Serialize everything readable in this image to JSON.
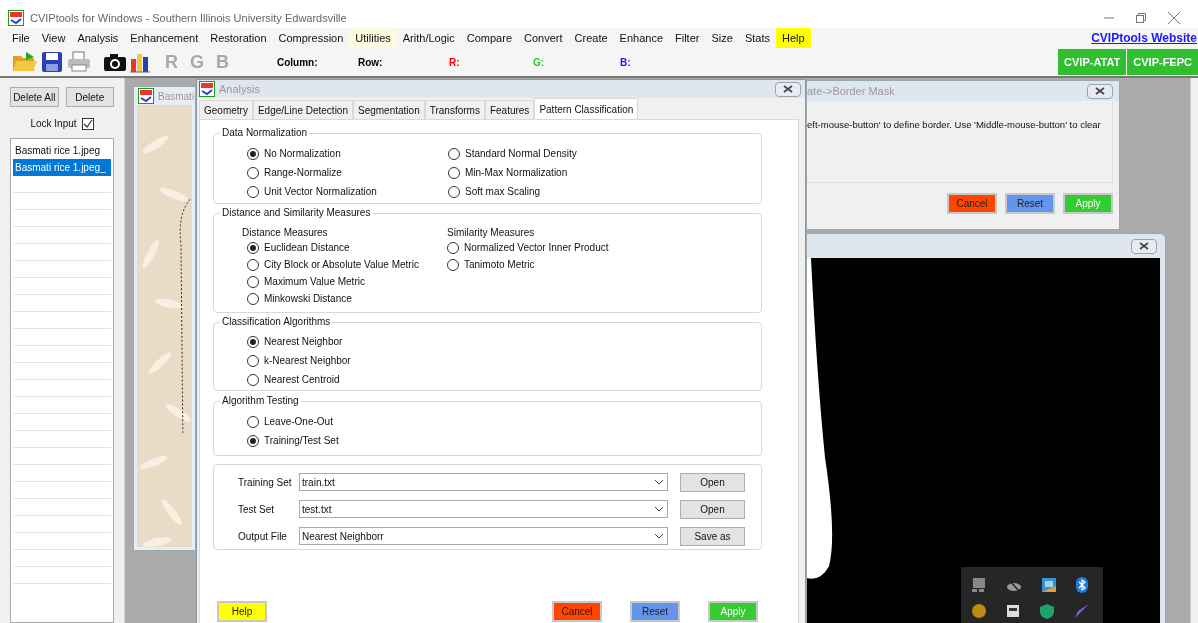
{
  "window": {
    "title": "CVIPtools for Windows - Southern Illinois University Edwardsville"
  },
  "menu": [
    {
      "label": "File"
    },
    {
      "label": "View"
    },
    {
      "label": "Analysis"
    },
    {
      "label": "Enhancement"
    },
    {
      "label": "Restoration"
    },
    {
      "label": "Compression"
    },
    {
      "label": "Utilities",
      "color": "#fbfbe0"
    },
    {
      "label": "Arith/Logic"
    },
    {
      "label": "Compare"
    },
    {
      "label": "Convert"
    },
    {
      "label": "Create"
    },
    {
      "label": "Enhance"
    },
    {
      "label": "Filter"
    },
    {
      "label": "Size"
    },
    {
      "label": "Stats"
    },
    {
      "label": "Help",
      "color": "#ffff00"
    }
  ],
  "website_link": "CVIPtools Website",
  "toolbar": {
    "channels": [
      "R",
      "G",
      "B"
    ],
    "readouts": [
      {
        "label": "Column:",
        "color": "#000000"
      },
      {
        "label": "Row:",
        "color": "#000000"
      },
      {
        "label": "R:",
        "color": "#ff0000"
      },
      {
        "label": "G:",
        "color": "#22cc22"
      },
      {
        "label": "B:",
        "color": "#1a1aff"
      }
    ],
    "tool_buttons": [
      "CVIP-ATAT",
      "CVIP-FEPC"
    ]
  },
  "left_panel": {
    "buttons": [
      "Delete All",
      "Delete"
    ],
    "lock_input": {
      "label": "Lock Input",
      "checked": true
    },
    "images": [
      {
        "name": "Basmati rice 1.jpeg",
        "selected": false
      },
      {
        "name": "Basmati rice 1.jpeg_",
        "selected": true
      }
    ]
  },
  "image_window": {
    "title": "Basmati"
  },
  "analysis": {
    "title": "Analysis",
    "tabs": [
      {
        "label": "Geometry",
        "selected": false
      },
      {
        "label": "Edge/Line Detection",
        "selected": false
      },
      {
        "label": "Segmentation",
        "selected": false
      },
      {
        "label": "Transforms",
        "selected": false
      },
      {
        "label": "Features",
        "selected": false
      },
      {
        "label": "Pattern Classification",
        "selected": true
      }
    ],
    "data_normalization": {
      "title": "Data Normalization",
      "columns": [
        [
          {
            "label": "No Normalization",
            "selected": true
          },
          {
            "label": "Range-Normalize",
            "selected": false
          },
          {
            "label": "Unit Vector Normalization",
            "selected": false
          }
        ],
        [
          {
            "label": "Standard Normal Density",
            "selected": false
          },
          {
            "label": "Min-Max Normalization",
            "selected": false
          },
          {
            "label": "Soft max Scaling",
            "selected": false
          }
        ]
      ]
    },
    "distance_similarity": {
      "title": "Distance and Similarity Measures",
      "sections": [
        {
          "heading": "Distance Measures",
          "options": [
            {
              "label": "Euclidean Distance",
              "selected": true
            },
            {
              "label": "City Block or Absolute Value Metric",
              "selected": false
            },
            {
              "label": "Maximum Value Metric",
              "selected": false
            },
            {
              "label": "Minkowski Distance",
              "selected": false
            }
          ]
        },
        {
          "heading": "Similarity Measures",
          "options": [
            {
              "label": "Normalized Vector Inner Product",
              "selected": false
            },
            {
              "label": "Tanimoto Metric",
              "selected": false
            }
          ]
        }
      ]
    },
    "classification": {
      "title": "Classification Algorithms",
      "options": [
        {
          "label": "Nearest Neighbor",
          "selected": true
        },
        {
          "label": "k-Nearest Neighbor",
          "selected": false
        },
        {
          "label": "Nearest Centroid",
          "selected": false
        }
      ]
    },
    "algorithm_testing": {
      "title": "Algorithm Testing",
      "options": [
        {
          "label": "Leave-One-Out",
          "selected": false
        },
        {
          "label": "Training/Test Set",
          "selected": true
        }
      ]
    },
    "files": [
      {
        "label": "Training Set",
        "value": "train.txt",
        "button": "Open"
      },
      {
        "label": "Test Set",
        "value": "test.txt",
        "button": "Open"
      },
      {
        "label": "Output File",
        "value": "Nearest Neighborr",
        "button": "Save as"
      }
    ],
    "buttons": [
      {
        "label": "Help",
        "color": "#ffff00"
      },
      {
        "label": "Cancel",
        "color": "#ff4500"
      },
      {
        "label": "Reset",
        "color": "#6495ed"
      },
      {
        "label": "Apply",
        "color": "#33cc33"
      }
    ]
  },
  "border_mask": {
    "title": "ate->Border Mask",
    "instructions": "eft-mouse-button' to define border. Use 'Middle-mouse-button' to clear",
    "buttons": [
      {
        "label": "Cancel",
        "color": "#ff4500"
      },
      {
        "label": "Reset",
        "color": "#6495ed"
      },
      {
        "label": "Apply",
        "color": "#33cc33"
      }
    ]
  }
}
